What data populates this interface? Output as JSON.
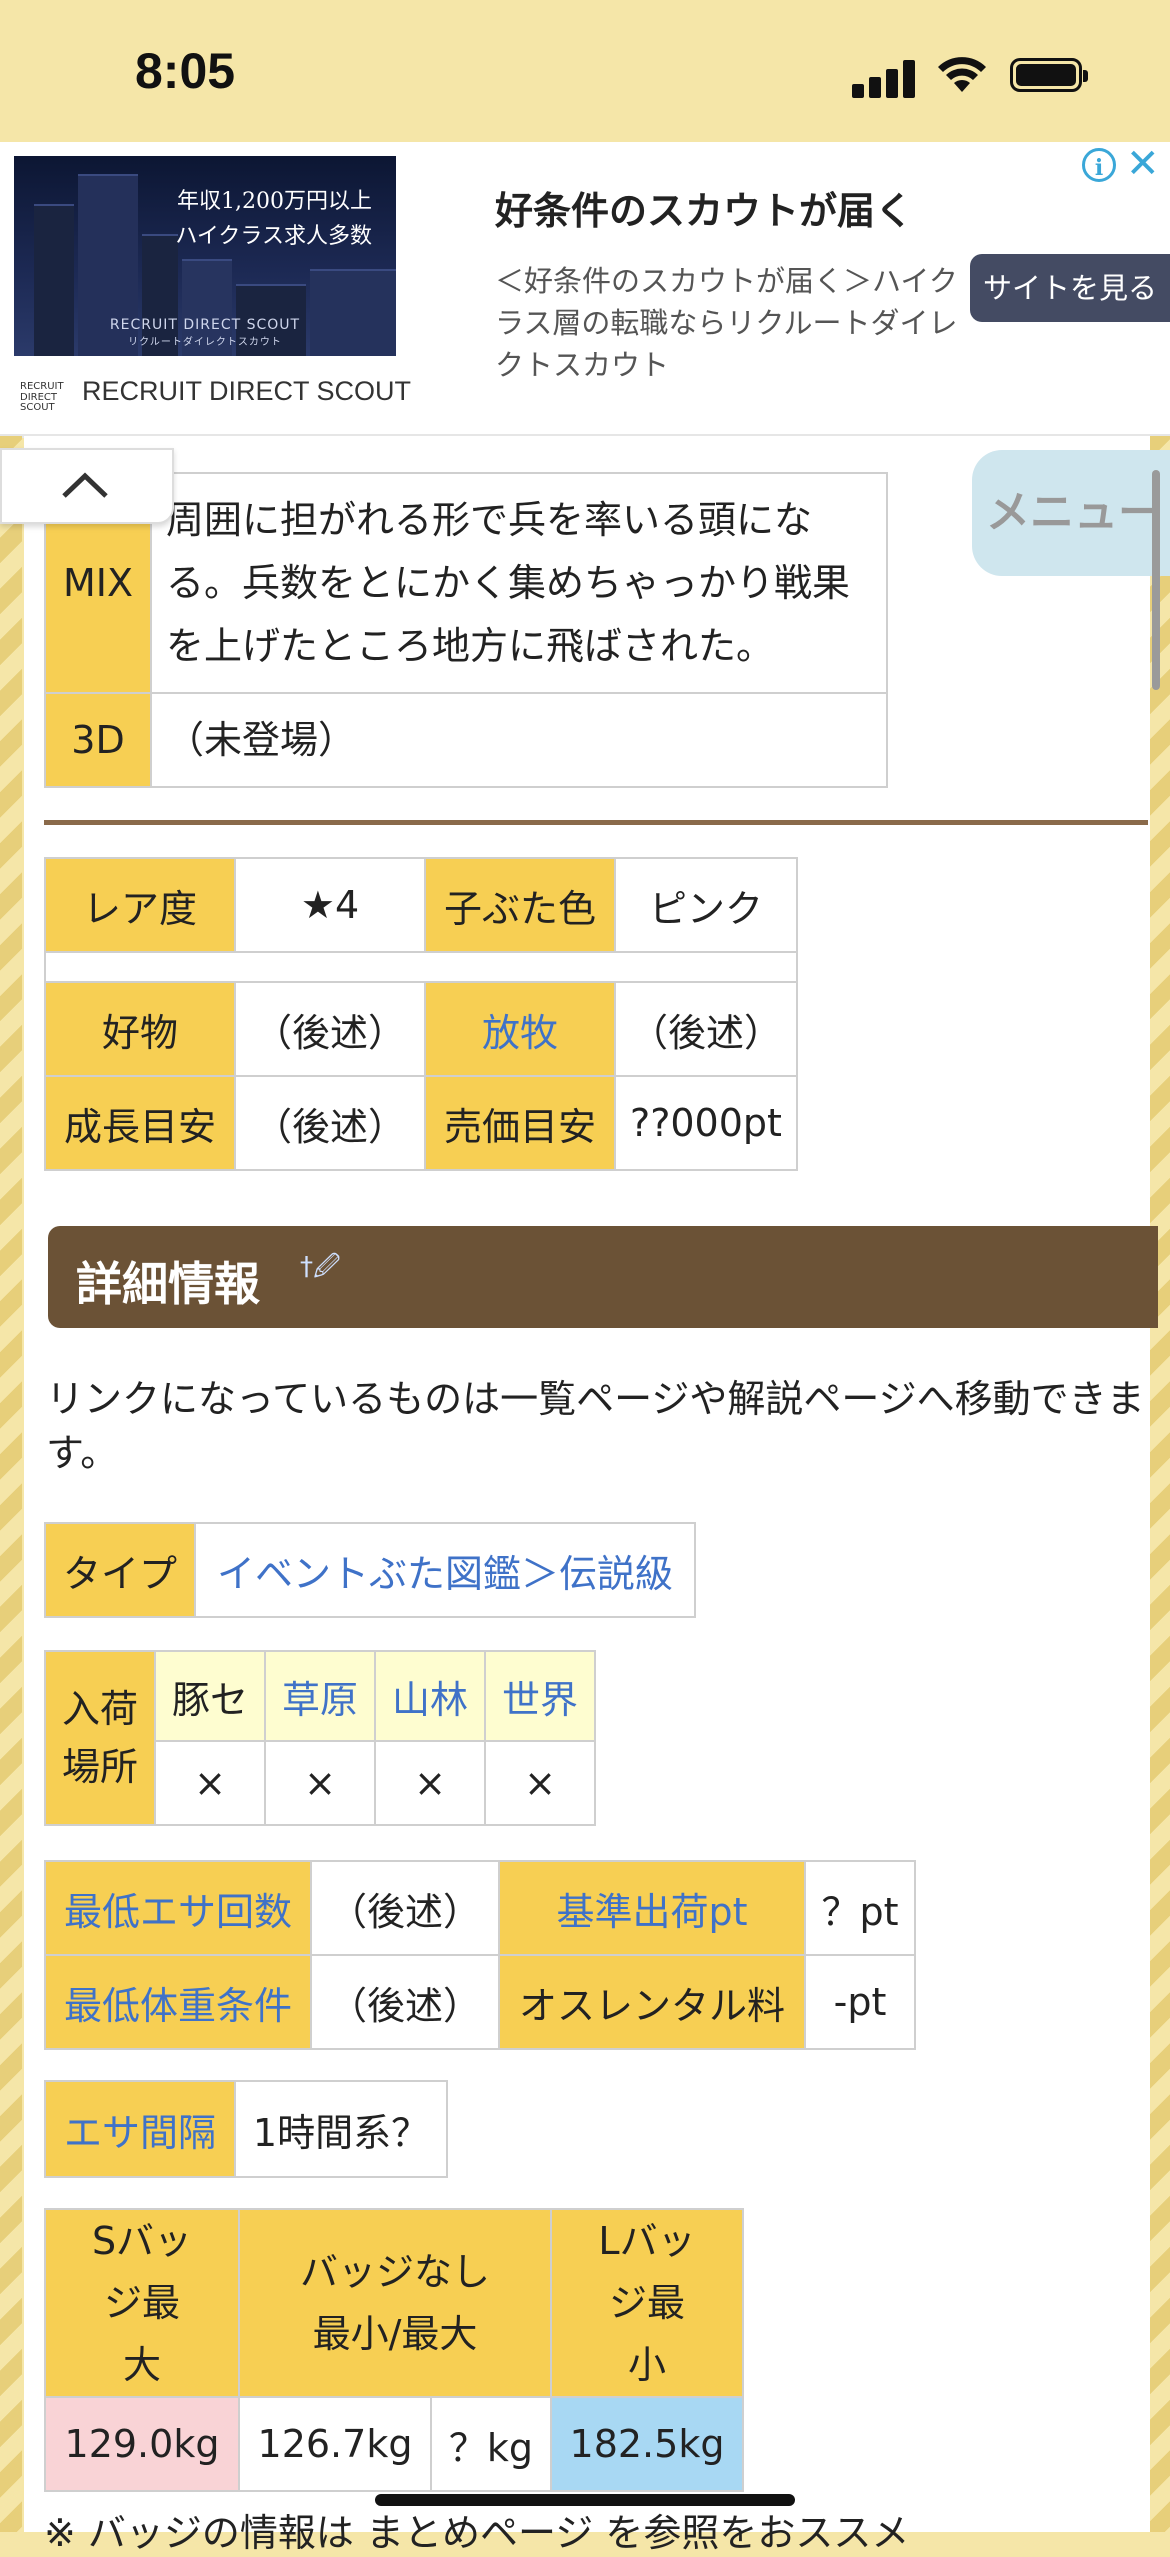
{
  "status": {
    "time": "8:05"
  },
  "ad": {
    "image_line1": "年収1,200万円以上",
    "image_line2": "ハイクラス求人多数",
    "image_footer": "RECRUIT DIRECT SCOUT",
    "image_footer_jp": "リクルートダイレクトスカウト",
    "brand": "RECRUIT DIRECT SCOUT",
    "title": "好条件のスカウトが届く",
    "description": "＜好条件のスカウトが届く＞ハイクラス層の転職ならリクルートダイレクトスカウト",
    "button": "サイトを見る",
    "info_glyph": "i",
    "close_glyph": "✕"
  },
  "menu": {
    "label": "メニュー"
  },
  "appearance": [
    {
      "label": "MIX",
      "value": "周囲に担がれる形で兵を率いる頭になる。兵数をとにかく集めちゃっかり戦果を上げたところ地方に飛ばされた。"
    },
    {
      "label": "3D",
      "value": "（未登場）"
    }
  ],
  "stats": {
    "rarity_label": "レア度",
    "rarity_value": "★4",
    "piglet_color_label": "子ぶた色",
    "piglet_color_value": "ピンク",
    "favorite_label": "好物",
    "favorite_value": "（後述）",
    "grazing_label": "放牧",
    "grazing_value": "（後述）",
    "growth_label": "成長目安",
    "growth_value": "（後述）",
    "price_label": "売価目安",
    "price_value": "??000pt"
  },
  "section": {
    "title": "詳細情報",
    "icons": "†🖉"
  },
  "note": "リンクになっているものは一覧ページや解説ページへ移動できます。",
  "type": {
    "label": "タイプ",
    "value": "イベントぶた図鑑＞伝説級"
  },
  "arrival": {
    "label": "入荷場所",
    "places": [
      "豚セ",
      "草原",
      "山林",
      "世界"
    ],
    "values": [
      "×",
      "×",
      "×",
      "×"
    ]
  },
  "shipping": {
    "min_feed_label": "最低エサ回数",
    "min_feed_value": "（後述）",
    "base_pt_label": "基準出荷pt",
    "base_pt_value": "？pt",
    "min_weight_label": "最低体重条件",
    "min_weight_value": "（後述）",
    "rental_label": "オスレンタル料",
    "rental_value": "-pt"
  },
  "feed_interval": {
    "label": "エサ間隔",
    "value": "1時間系？"
  },
  "weights": {
    "s_badge_label": "Sバッジ最大",
    "no_badge_label": "バッジなし最小/最大",
    "l_badge_label": "Lバッジ最小",
    "s_badge_max": "129.0kg",
    "no_badge_min": "126.7kg",
    "no_badge_max": "？kg",
    "l_badge_min": "182.5kg"
  },
  "bottom": {
    "text": "※ バッジの情報は まとめページ を参照をおススメ"
  }
}
